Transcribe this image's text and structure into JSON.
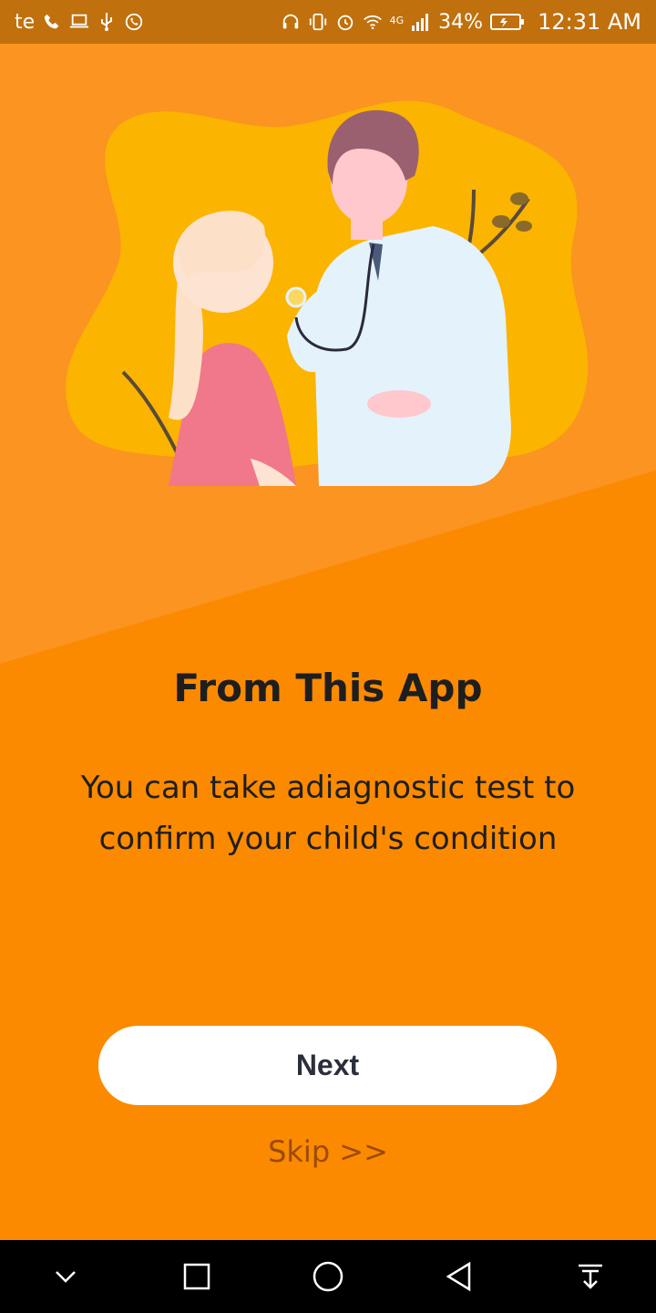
{
  "status_bar": {
    "carrier": "te",
    "battery": "34%",
    "network": "4G",
    "time": "12:31 AM",
    "icons_left": [
      "phone-icon",
      "laptop-icon",
      "usb-icon",
      "whatsapp-icon"
    ],
    "icons_right": [
      "headset-icon",
      "vibrate-icon",
      "alarm-icon",
      "wifi-icon",
      "signal-icon",
      "battery-icon"
    ]
  },
  "onboarding": {
    "title": "From This App",
    "description": "You can take adiagnostic test to confirm your child's condition",
    "next_label": "Next",
    "skip_label": "Skip >>"
  },
  "nav_bar": {
    "buttons": [
      "chevron-down-icon",
      "recents-icon",
      "home-icon",
      "back-icon",
      "notification-pull-icon"
    ]
  },
  "colors": {
    "background": "#fb8a00",
    "hero_background": "#fb9420",
    "blob": "#fbb400",
    "text": "#1e1e1e",
    "button": "#ffffff",
    "skip": "#9a4a0a"
  }
}
